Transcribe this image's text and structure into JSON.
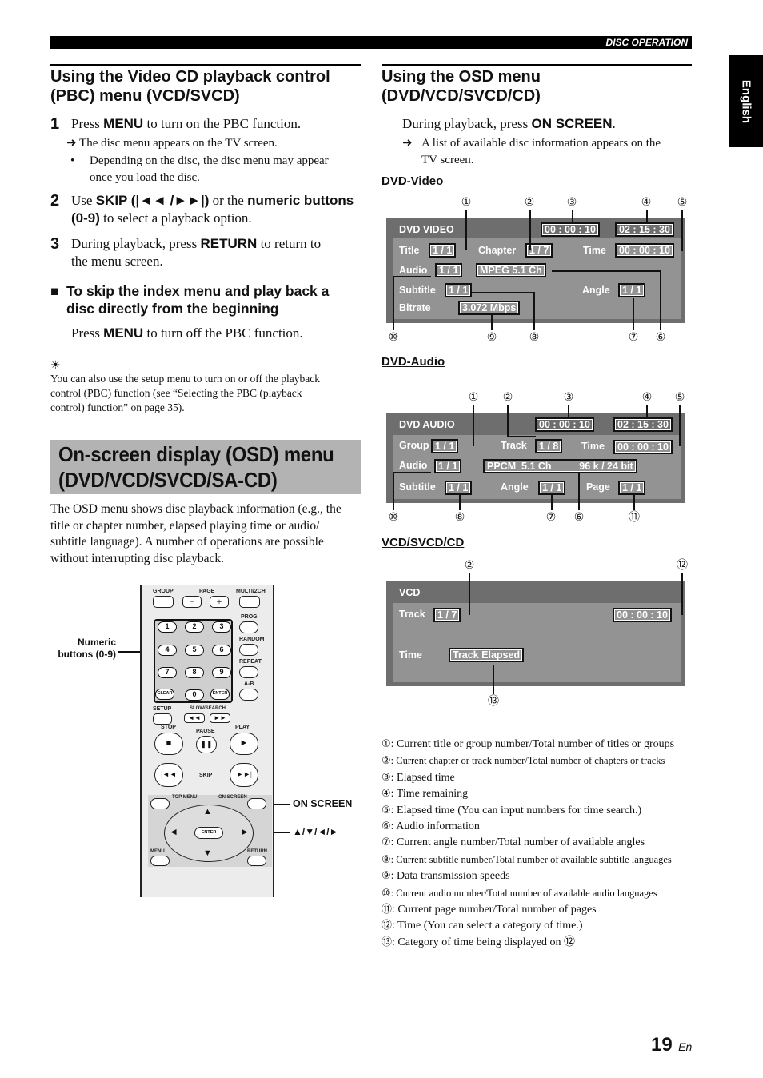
{
  "header": {
    "section": "DISC OPERATION",
    "language_tab": "English"
  },
  "left": {
    "pbc": {
      "title_line1": "Using the Video CD playback control",
      "title_line2": "(PBC) menu (VCD/SVCD)",
      "steps": [
        {
          "num": "1",
          "pre": "Press ",
          "bold": "MENU",
          "post": " to turn on the PBC function.",
          "result": "The disc menu appears on the TV screen.",
          "bullet_line1": "Depending on the disc, the disc menu may appear",
          "bullet_line2": "once you load the disc."
        },
        {
          "num": "2",
          "pre": "Use ",
          "bold": "SKIP (|◄◄ /►►|)",
          "mid": " or the ",
          "bold2": "numeric buttons",
          "line2_bold": "(0-9)",
          "line2": " to select a playback option."
        },
        {
          "num": "3",
          "pre": "During playback, press ",
          "bold": "RETURN",
          "post": " to return to",
          "line2": "the menu screen."
        }
      ],
      "subsection_line1": "To skip the index menu and play back a",
      "subsection_line2": "disc directly from the beginning",
      "sub_pre": "Press ",
      "sub_bold": "MENU",
      "sub_post": " to turn off the PBC function.",
      "tip_lines": [
        "You can also use the setup menu to turn on or off the playback",
        "control (PBC) function (see “Selecting the PBC (playback",
        "control) function” on page 35)."
      ]
    },
    "osd": {
      "title_line1": "On-screen display (OSD) menu",
      "title_line2": "(DVD/VCD/SVCD/SA-CD)",
      "body_lines": [
        "The OSD menu shows disc playback information (e.g., the",
        "title or chapter number, elapsed playing time or audio/",
        "subtitle language). A number of operations are possible",
        "without interrupting disc playback."
      ]
    },
    "remote": {
      "callout_numeric_line1": "Numeric",
      "callout_numeric_line2": "buttons (0-9)",
      "callout_onscreen": "ON SCREEN",
      "callout_arrows": "▲/▼/◄/►",
      "labels": {
        "group": "GROUP",
        "page": "PAGE",
        "multi": "MULTI/2CH",
        "prog": "PROG",
        "random": "RANDOM",
        "repeat": "REPEAT",
        "ab": "A-B",
        "clear": "CLEAR",
        "enter": "ENTER",
        "setup": "SETUP",
        "slow": "SLOW/SEARCH",
        "stop": "STOP",
        "pause": "PAUSE",
        "play": "PLAY",
        "skip": "SKIP",
        "topmenu": "TOP MENU",
        "onscreen": "ON SCREEN",
        "menu": "MENU",
        "return": "RETURN",
        "minus": "−",
        "plus": "+"
      },
      "keys": [
        "1",
        "2",
        "3",
        "4",
        "5",
        "6",
        "7",
        "8",
        "9",
        "0"
      ]
    }
  },
  "right": {
    "title_line1": "Using the OSD menu",
    "title_line2": "(DVD/VCD/SVCD/CD)",
    "instr_pre": "During playback, press ",
    "instr_bold": "ON SCREEN",
    "instr_post": ".",
    "result_line1": "A list of available disc information appears on the",
    "result_line2": "TV screen.",
    "dvd_video": {
      "heading": "DVD-Video",
      "screen_title": "DVD VIDEO",
      "elapsed": "00 : 00 : 10",
      "remaining": "02 : 15 : 30",
      "title_label": "Title",
      "title_val": "1 / 1",
      "chapter_label": "Chapter",
      "chapter_val": "1 / 7",
      "time_label": "Time",
      "time_val": "00 : 00 : 10",
      "audio_label": "Audio",
      "audio_val": "1 / 1",
      "audio_info": "MPEG  5.1 Ch",
      "subtitle_label": "Subtitle",
      "subtitle_val": "1 / 1",
      "angle_label": "Angle",
      "angle_val": "1 / 1",
      "bitrate_label": "Bitrate",
      "bitrate_val": "3.072 Mbps"
    },
    "dvd_audio": {
      "heading": "DVD-Audio",
      "screen_title": "DVD AUDIO",
      "elapsed": "00 : 00 : 10",
      "remaining": "02 : 15 : 30",
      "group_label": "Group",
      "group_val": "1 / 1",
      "track_label": "Track",
      "track_val": "1 / 8",
      "time_label": "Time",
      "time_val": "00 : 00 : 10",
      "audio_label": "Audio",
      "audio_val": "1 / 1",
      "audio_info": "PPCM  5.1 Ch          96 k / 24 bit",
      "subtitle_label": "Subtitle",
      "subtitle_val": "1 / 1",
      "angle_label": "Angle",
      "angle_val": "1 / 1",
      "page_label": "Page",
      "page_val": "1 / 1"
    },
    "vcd": {
      "heading": "VCD/SVCD/CD",
      "screen_title": "VCD",
      "track_label": "Track",
      "track_val": "1 / 7",
      "time_val": "00 : 00 : 10",
      "time_label": "Time",
      "time_category": "Track Elapsed"
    },
    "callouts": [
      "①",
      "②",
      "③",
      "④",
      "⑤",
      "⑥",
      "⑦",
      "⑧",
      "⑨",
      "⑩",
      "⑪",
      "⑫",
      "⑬"
    ],
    "legend": [
      {
        "mark": "①",
        "text": ": Current title or group number/Total number of titles or groups"
      },
      {
        "mark": "②",
        "text": ": Current chapter or track number/Total number of chapters or tracks"
      },
      {
        "mark": "③",
        "text": ": Elapsed time"
      },
      {
        "mark": "④",
        "text": ": Time remaining"
      },
      {
        "mark": "⑤",
        "text": ": Elapsed time (You can input numbers for time search.)"
      },
      {
        "mark": "⑥",
        "text": ": Audio information"
      },
      {
        "mark": "⑦",
        "text": ": Current angle number/Total number of available angles"
      },
      {
        "mark": "⑧",
        "text": ": Current subtitle number/Total number of available subtitle languages"
      },
      {
        "mark": "⑨",
        "text": ": Data transmission speeds"
      },
      {
        "mark": "⑩",
        "text": ": Current audio number/Total number of available audio languages"
      },
      {
        "mark": "⑪",
        "text": ": Current page number/Total number of pages"
      },
      {
        "mark": "⑫",
        "text": ": Time (You can select a category of time.)"
      },
      {
        "mark": "⑬",
        "text": ": Category of time being displayed on ⑫"
      }
    ]
  },
  "footer": {
    "page_number": "19",
    "page_lang": "En"
  }
}
